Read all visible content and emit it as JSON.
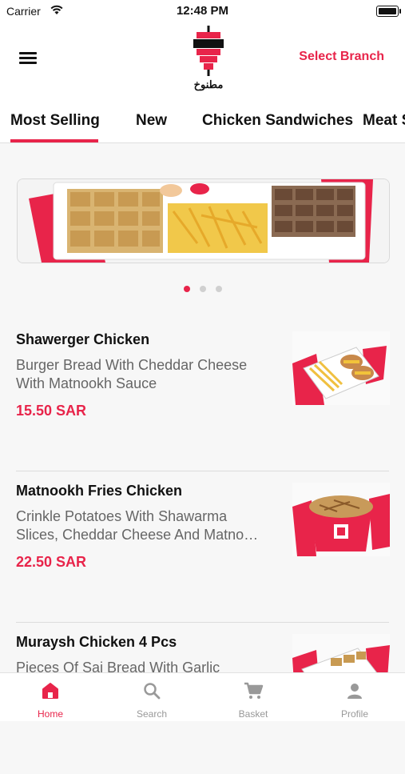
{
  "status_bar": {
    "carrier": "Carrier",
    "time": "12:48 PM"
  },
  "header": {
    "logo_text": "مطنوخ",
    "select_branch": "Select Branch"
  },
  "tabs": [
    "Most Selling",
    "New",
    "Chicken Sandwiches",
    "Meat S"
  ],
  "active_tab": "Most Selling",
  "carousel": {
    "active_index": 0,
    "count": 3
  },
  "items": [
    {
      "name": "Shawerger Chicken",
      "desc": "Burger Bread With Cheddar Cheese With Matnookh Sauce",
      "price": "15.50 SAR"
    },
    {
      "name": "Matnookh Fries Chicken",
      "desc": "Crinkle Potatoes With Shawarma Slices, Cheddar Cheese And Matno…",
      "price": "22.50 SAR"
    },
    {
      "name": "Muraysh Chicken 4 Pcs",
      "desc": "Pieces Of Saj Bread With Garlic",
      "price": ""
    }
  ],
  "tabbar": [
    {
      "label": "Home",
      "icon": "home-icon"
    },
    {
      "label": "Search",
      "icon": "search-icon"
    },
    {
      "label": "Basket",
      "icon": "cart-icon"
    },
    {
      "label": "Profile",
      "icon": "profile-icon"
    }
  ],
  "colors": {
    "accent": "#e8244a",
    "background": "#f7f7f7",
    "muted": "#999999"
  }
}
